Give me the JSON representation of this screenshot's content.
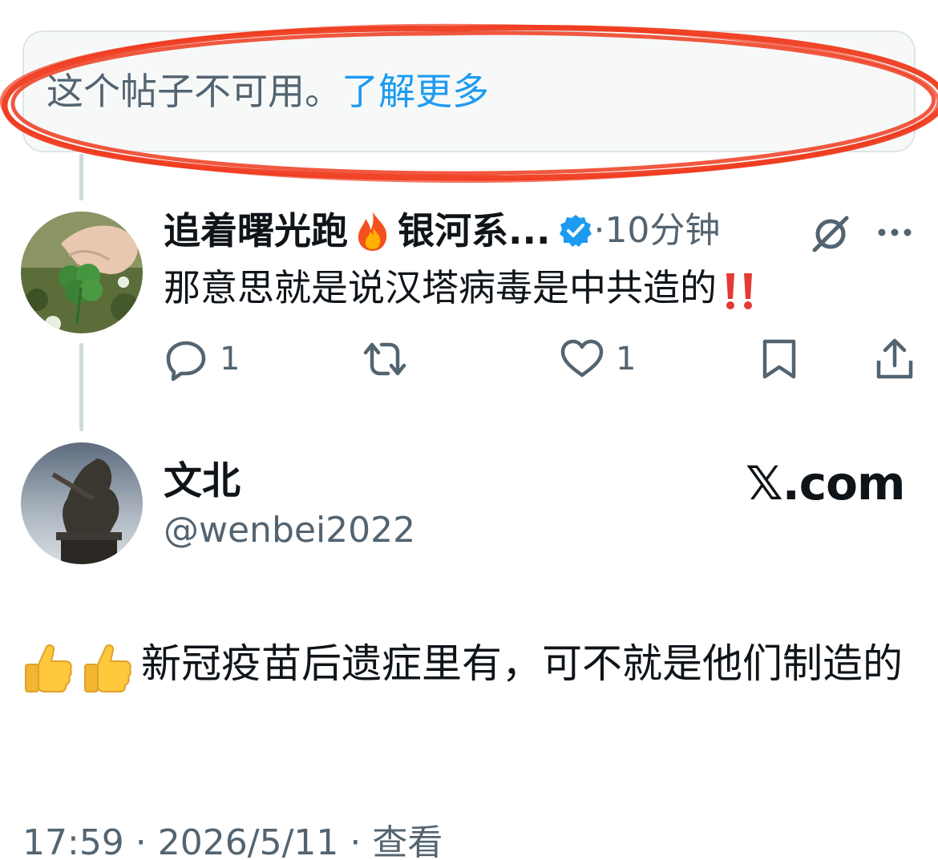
{
  "notice": {
    "text": "这个帖子不可用。",
    "link": "了解更多"
  },
  "reply": {
    "display_name": "追着曙光跑🔥银河系...",
    "name_part1": "追着曙光跑",
    "name_part2": "银河系...",
    "separator": "·",
    "time": "10分钟",
    "text": "那意思就是说汉塔病毒是中共造的‼️",
    "text_plain": "那意思就是说汉塔病毒是中共造的",
    "actions": {
      "reply_count": "1",
      "like_count": "1"
    }
  },
  "post": {
    "author_name": "文北",
    "author_handle": "@wenbei2022",
    "brand": "𝕏.com",
    "text": "👍👍新冠疫苗后遗症里有，可不就是他们制造的",
    "text_plain": "新冠疫苗后遗症里有，可不就是他们制造的",
    "time": "17:59",
    "date": "2026/5/11",
    "view_label": "查看",
    "meta_separator": " · "
  },
  "colors": {
    "link_blue": "#1d9bf0",
    "secondary_text": "#536471",
    "annotation_red": "#ef3b1e",
    "verified_blue": "#1d9bf0"
  },
  "icons": [
    "fire-emoji",
    "verified-badge-icon",
    "grok-icon",
    "more-icon",
    "reply-icon",
    "repost-icon",
    "like-icon",
    "bookmark-icon",
    "share-icon",
    "thumbs-up-emoji",
    "double-exclamation-emoji"
  ]
}
